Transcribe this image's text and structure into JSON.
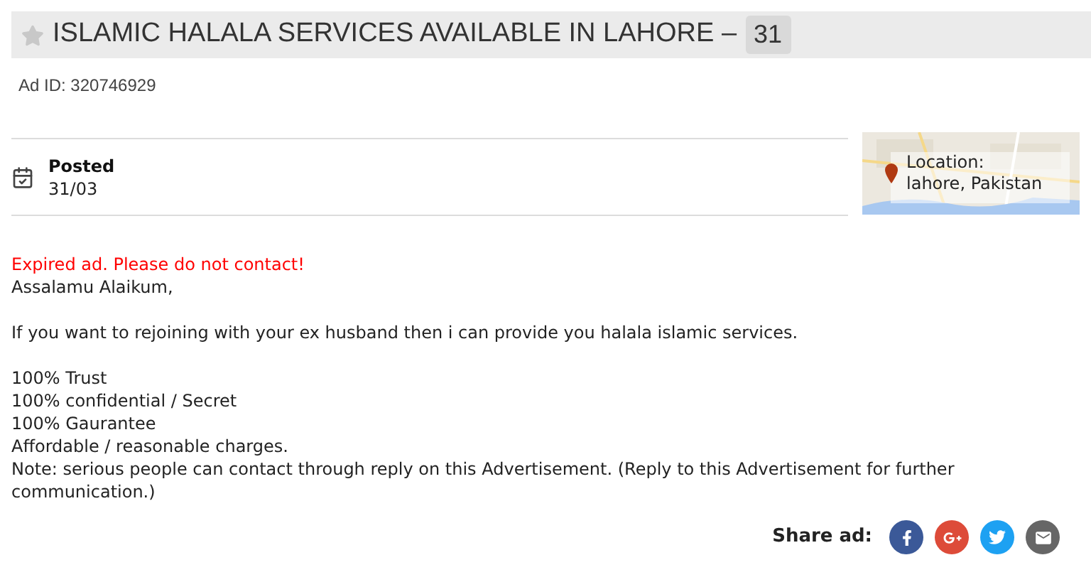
{
  "title": {
    "text": "ISLAMIC HALALA SERVICES AVAILABLE IN LAHORE –",
    "count": "31",
    "starred": false
  },
  "ad_id": "Ad ID: 320746929",
  "posted": {
    "label": "Posted",
    "date": "31/03"
  },
  "location": {
    "label": "Location:",
    "value": "lahore, Pakistan"
  },
  "notice": "Expired ad. Please do not contact!",
  "body": [
    {
      "lines": [
        "Assalamu Alaikum,"
      ]
    },
    {
      "lines": [
        "If you want to rejoining with your ex husband then i can provide you halala islamic services."
      ]
    },
    {
      "lines": [
        "100% Trust",
        "100% confidential / Secret",
        "100% Gaurantee",
        "Affordable / reasonable charges.",
        "Note: serious people can contact through reply on this Advertisement. (Reply to this Advertisement for further communication.)"
      ]
    }
  ],
  "share": {
    "label": "Share ad:",
    "buttons": [
      {
        "kind": "facebook",
        "color": "#3b5998"
      },
      {
        "kind": "googleplus",
        "color": "#dd4b39"
      },
      {
        "kind": "twitter",
        "color": "#1da1f2"
      },
      {
        "kind": "email",
        "color": "#666666"
      }
    ]
  }
}
